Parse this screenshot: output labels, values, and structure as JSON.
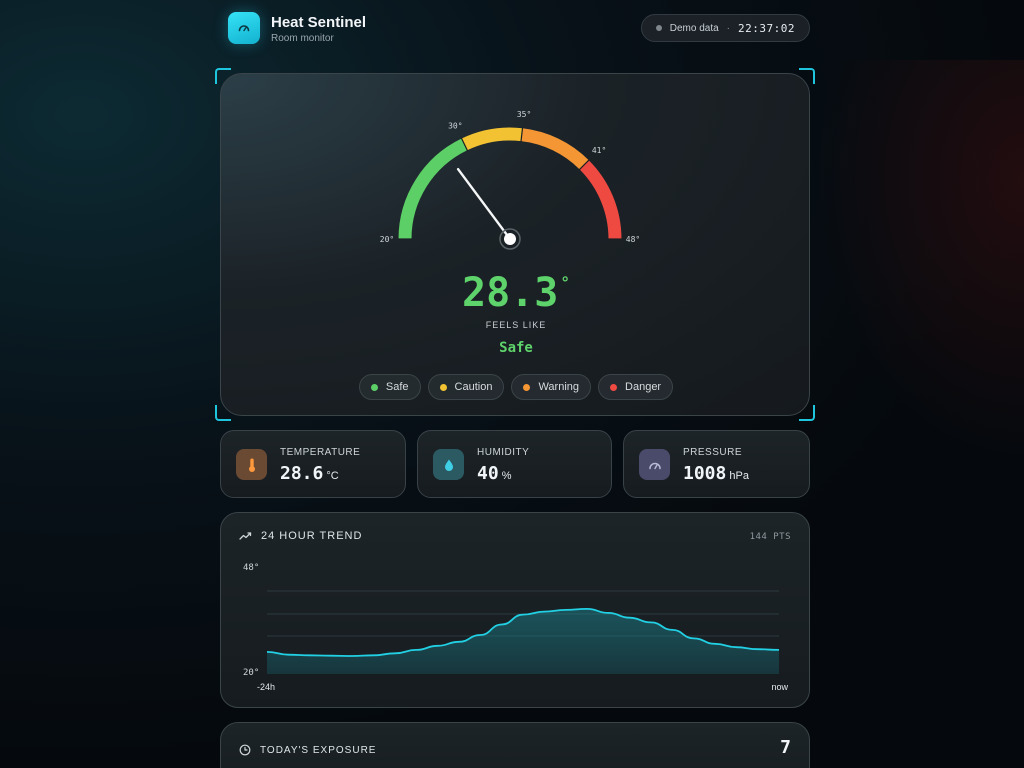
{
  "app": {
    "title": "Heat Sentinel",
    "subtitle": "Room monitor",
    "mode_label": "Demo data",
    "separator": "·",
    "clock": "22:37:02",
    "accent": "#1ec5dc",
    "logo_icon": "gauge-icon"
  },
  "gauge": {
    "min": 20,
    "max": 48,
    "ticks": [
      "20°",
      "30°",
      "35°",
      "41°",
      "48°"
    ],
    "zones": [
      {
        "name": "Safe",
        "from": 20,
        "to": 30,
        "color": "#5ccf66"
      },
      {
        "name": "Caution",
        "from": 30,
        "to": 35,
        "color": "#f2c232"
      },
      {
        "name": "Warning",
        "from": 35,
        "to": 41,
        "color": "#f39633"
      },
      {
        "name": "Danger",
        "from": 41,
        "to": 48,
        "color": "#ef4a42"
      }
    ],
    "value": 28.3,
    "value_text": "28.3",
    "unit": "°",
    "caption": "FEELS LIKE",
    "status": "Safe",
    "status_color": "#5fd36b"
  },
  "legend": [
    {
      "label": "Safe",
      "color": "#5ccf66"
    },
    {
      "label": "Caution",
      "color": "#f2c232"
    },
    {
      "label": "Warning",
      "color": "#f39633"
    },
    {
      "label": "Danger",
      "color": "#ef4a42"
    }
  ],
  "stats": [
    {
      "label": "TEMPERATURE",
      "value": "28.6",
      "unit": "°C",
      "icon": "thermometer-icon",
      "icon_bg": "#6b4a33",
      "icon_color": "#ff9a3c"
    },
    {
      "label": "HUMIDITY",
      "value": "40",
      "unit": "%",
      "icon": "water-drop-icon",
      "icon_bg": "#2b5a63",
      "icon_color": "#3fd0e6"
    },
    {
      "label": "PRESSURE",
      "value": "1008",
      "unit": "hPa",
      "icon": "gauge-icon",
      "icon_bg": "#4a4a6a",
      "icon_color": "#b9b9d6"
    }
  ],
  "trend": {
    "title": "24 HOUR TREND",
    "points_label": "144 PTS",
    "y_top_label": "48°",
    "y_bottom_label": "20°",
    "x_start_label": "-24h",
    "x_end_label": "now",
    "icon": "trend-line-icon"
  },
  "chart_data": {
    "type": "area",
    "ylim": [
      20,
      48
    ],
    "xlabel": "",
    "ylabel": "",
    "x": [
      -24,
      -23,
      -22,
      -21,
      -20,
      -19,
      -18,
      -17,
      -16,
      -15,
      -14,
      -13,
      -12,
      -11,
      -10,
      -9,
      -8,
      -7,
      -6,
      -5,
      -4,
      -3,
      -2,
      -1,
      0
    ],
    "series": [
      {
        "values": [
          26.5,
          25.7,
          25.5,
          25.4,
          25.3,
          25.5,
          26.1,
          27.1,
          28.3,
          29.5,
          31.5,
          34.6,
          37.5,
          38.4,
          38.9,
          39.2,
          38.0,
          36.6,
          35.2,
          33.0,
          30.5,
          28.9,
          27.9,
          27.3,
          27.1
        ],
        "color": "#22d0e4"
      }
    ],
    "grid": true
  },
  "exposure": {
    "title": "TODAY'S EXPOSURE",
    "count": "7",
    "icon": "clock-icon"
  }
}
